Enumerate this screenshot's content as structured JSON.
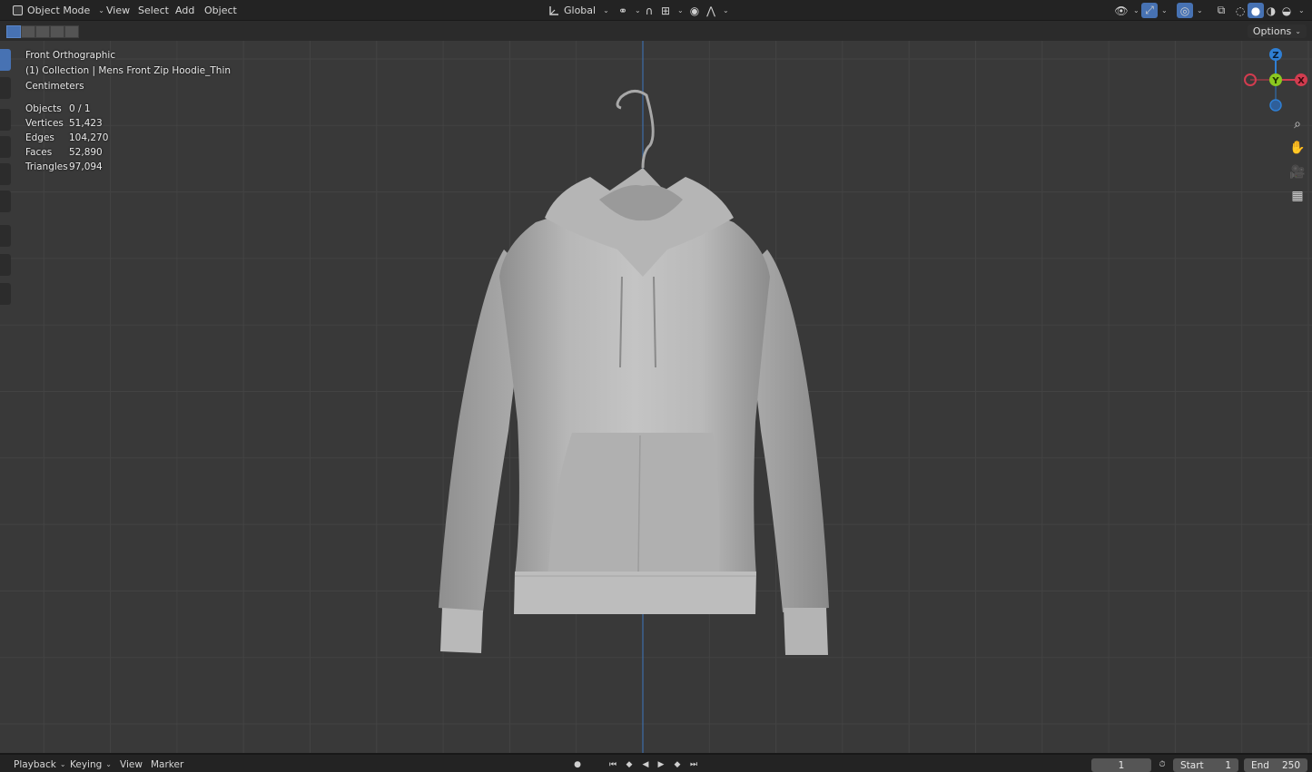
{
  "header": {
    "mode_label": "Object Mode",
    "menus": [
      "View",
      "Select",
      "Add",
      "Object"
    ],
    "transform_orientation": "Global"
  },
  "subheader": {
    "options_label": "Options"
  },
  "viewport": {
    "view_name": "Front Orthographic",
    "collection_line": "(1) Collection | Mens Front Zip Hoodie_Thin",
    "units": "Centimeters",
    "stats": [
      {
        "label": "Objects",
        "value": "0 / 1"
      },
      {
        "label": "Vertices",
        "value": "51,423"
      },
      {
        "label": "Edges",
        "value": "104,270"
      },
      {
        "label": "Faces",
        "value": "52,890"
      },
      {
        "label": "Triangles",
        "value": "97,094"
      }
    ],
    "gizmo": {
      "z": "Z",
      "y": "Y",
      "x": "X"
    },
    "colors": {
      "axis_x": "#d23c4f",
      "axis_y": "#8bc820",
      "axis_z": "#2f7fd4",
      "accent": "#4772b3"
    }
  },
  "timeline": {
    "menus": [
      "Playback",
      "Keying",
      "View",
      "Marker"
    ],
    "current_frame": "1",
    "start_label": "Start",
    "start_value": "1",
    "end_label": "End",
    "end_value": "250"
  }
}
